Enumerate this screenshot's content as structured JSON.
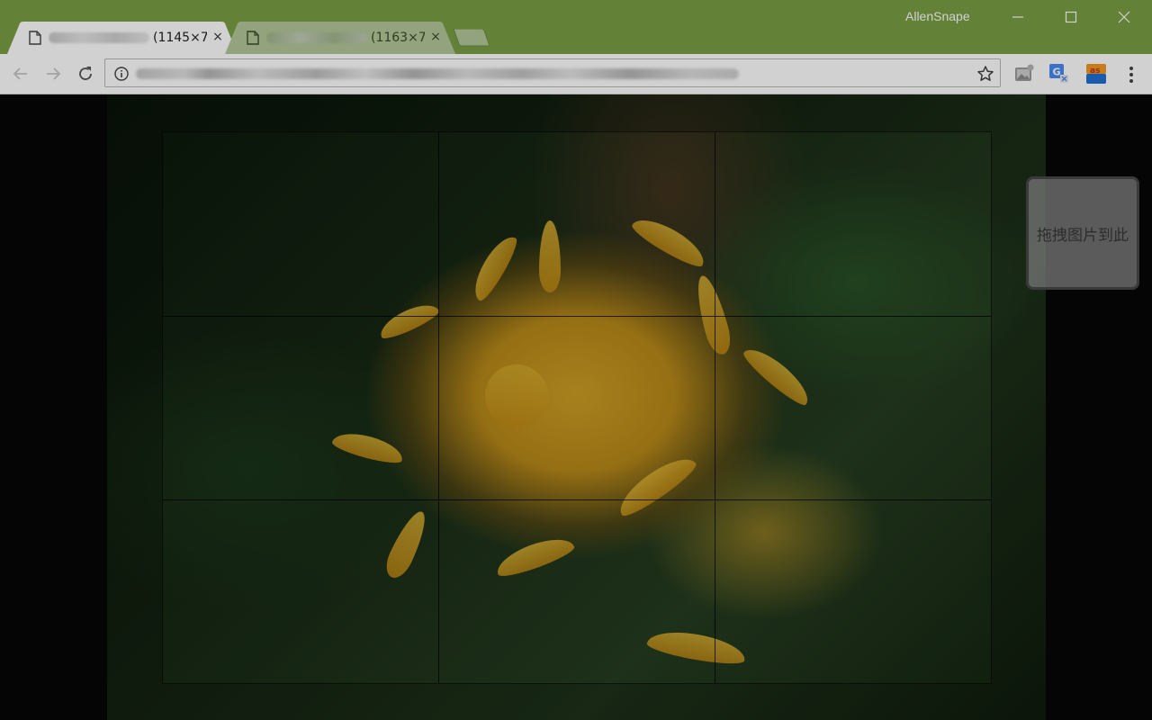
{
  "window": {
    "profile_name": "AllenSnape",
    "controls": [
      "minimize",
      "maximize",
      "close"
    ]
  },
  "tabs": [
    {
      "title_suffix": "(1145×7",
      "active": true,
      "icon": "page-icon",
      "close_label": "×"
    },
    {
      "title_suffix": "(1163×7",
      "active": false,
      "icon": "page-icon",
      "close_label": "×"
    }
  ],
  "toolbar": {
    "back_icon": "arrow-left-icon",
    "forward_icon": "arrow-right-icon",
    "reload_icon": "reload-icon",
    "omnibox": {
      "info_icon": "info-icon",
      "url": "",
      "bookmark_icon": "star-icon"
    },
    "extensions": [
      "image-extension-icon",
      "google-translate-icon",
      "as-extension-icon"
    ],
    "menu_icon": "kebab-menu-icon"
  },
  "viewer": {
    "drop_zone_label": "拖拽图片到此",
    "grid": "3x3"
  },
  "colors": {
    "frame": "#7a9e45",
    "toolbar": "#ffffff",
    "viewport": "#070707"
  }
}
